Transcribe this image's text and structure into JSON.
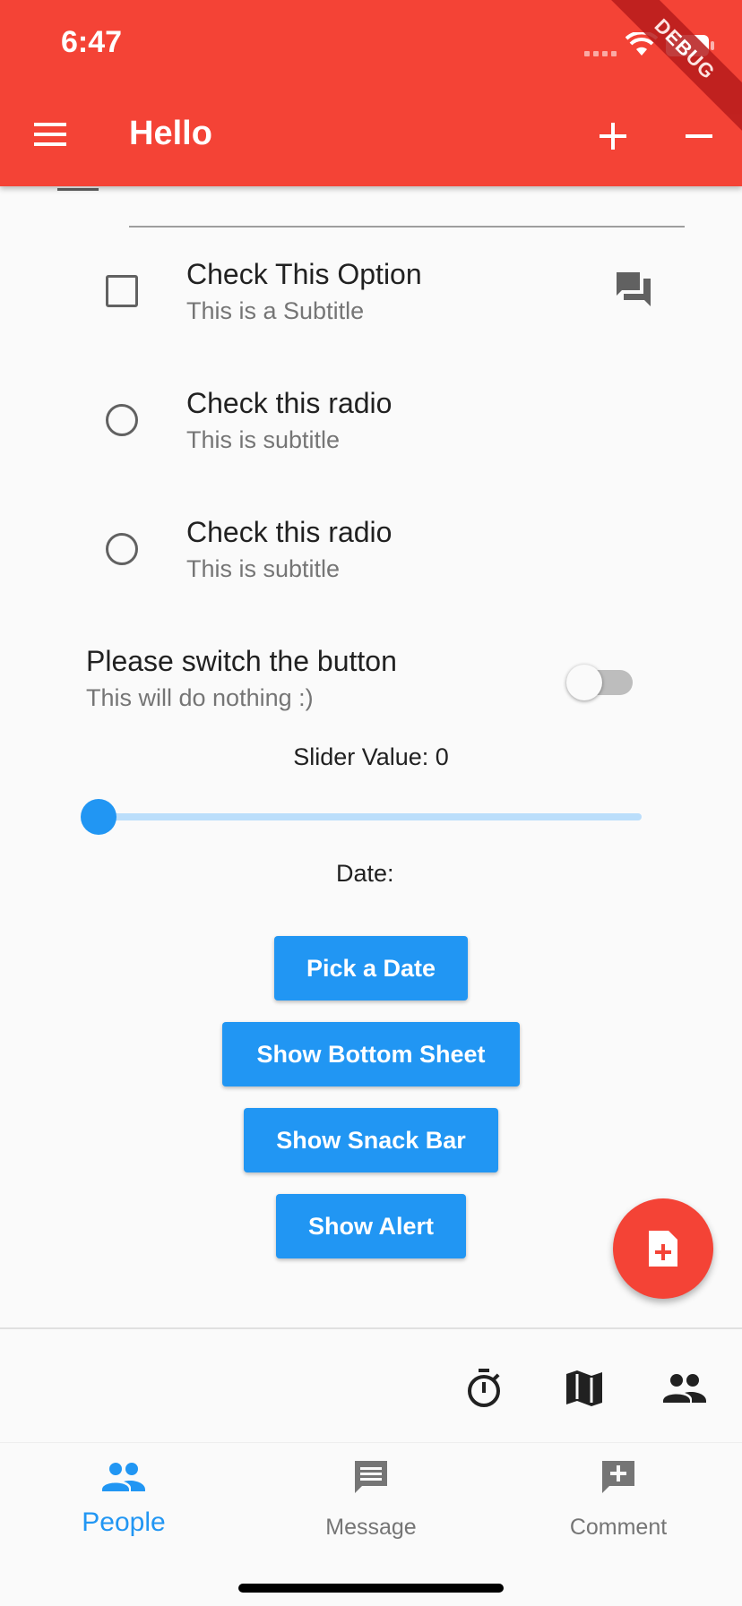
{
  "status_bar": {
    "time": "6:47"
  },
  "app_bar": {
    "title": "Hello"
  },
  "debug_banner": "DEBUG",
  "checkbox_tile": {
    "title": "Check This Option",
    "subtitle": "This is a Subtitle",
    "checked": false
  },
  "radio_tiles": [
    {
      "title": "Check this radio",
      "subtitle": "This is subtitle",
      "selected": false
    },
    {
      "title": "Check this radio",
      "subtitle": "This is subtitle",
      "selected": false
    }
  ],
  "switch_tile": {
    "title": "Please switch the button",
    "subtitle": "This will do nothing :)",
    "on": false
  },
  "slider": {
    "label": "Slider Value: 0",
    "value": 0
  },
  "date": {
    "label": "Date:"
  },
  "buttons": {
    "pick_date": "Pick a Date",
    "bottom_sheet": "Show Bottom Sheet",
    "snack_bar": "Show Snack Bar",
    "alert": "Show Alert"
  },
  "bottom_nav": {
    "items": [
      {
        "label": "People",
        "active": true
      },
      {
        "label": "Message",
        "active": false
      },
      {
        "label": "Comment",
        "active": false
      }
    ]
  },
  "colors": {
    "primary": "#f44336",
    "accent": "#2196f3",
    "text": "#212121",
    "subtext": "#757575"
  }
}
